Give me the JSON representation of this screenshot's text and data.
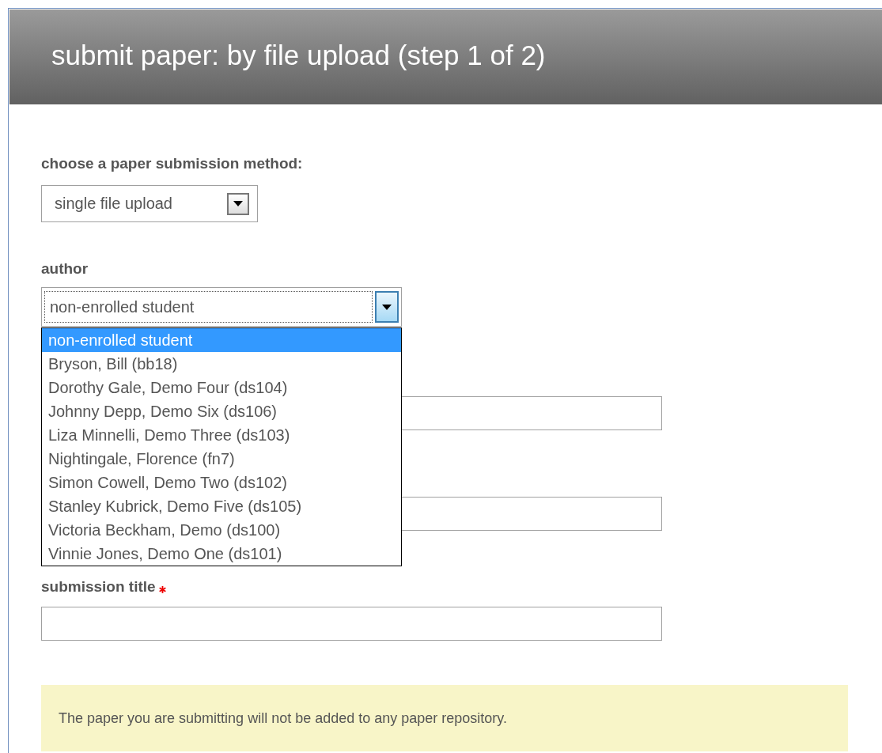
{
  "header": {
    "title": "submit paper: by file upload (step 1 of 2)"
  },
  "method": {
    "label": "choose a paper submission method:",
    "value": "single file upload"
  },
  "author": {
    "label": "author",
    "value": "non-enrolled student",
    "expanded": true,
    "options": [
      {
        "label": "non-enrolled student",
        "selected": true
      },
      {
        "label": "Bryson, Bill (bb18)",
        "selected": false
      },
      {
        "label": "Dorothy Gale, Demo Four (ds104)",
        "selected": false
      },
      {
        "label": "Johnny Depp, Demo Six (ds106)",
        "selected": false
      },
      {
        "label": "Liza Minnelli, Demo Three (ds103)",
        "selected": false
      },
      {
        "label": "Nightingale, Florence (fn7)",
        "selected": false
      },
      {
        "label": "Simon Cowell, Demo Two (ds102)",
        "selected": false
      },
      {
        "label": "Stanley Kubrick, Demo Five (ds105)",
        "selected": false
      },
      {
        "label": "Victoria Beckham, Demo (ds100)",
        "selected": false
      },
      {
        "label": "Vinnie Jones, Demo One (ds101)",
        "selected": false
      }
    ]
  },
  "hidden_fields": [
    {
      "kind": "input"
    },
    {
      "kind": "input"
    }
  ],
  "title_field": {
    "label": "submission title",
    "required": true
  },
  "notice": "The paper you are submitting will not be added to any paper repository."
}
